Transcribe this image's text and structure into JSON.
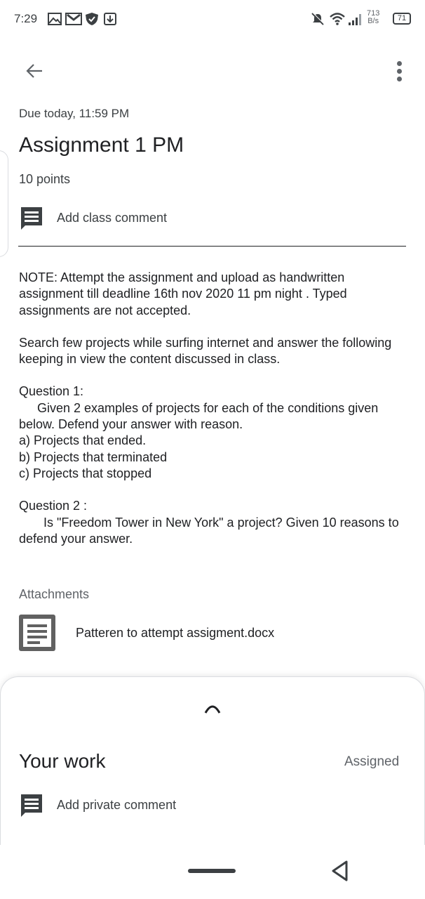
{
  "status_bar": {
    "time": "7:29",
    "net_speed_value": "713",
    "net_speed_unit": "B/s",
    "battery": "71",
    "icons": [
      "image-icon",
      "gmail-icon",
      "shield-icon",
      "download-icon",
      "mute-icon",
      "wifi-icon",
      "signal-icon"
    ]
  },
  "app_bar": {
    "back_icon": "arrow-left-icon",
    "more_icon": "more-vert-icon"
  },
  "assignment": {
    "due": "Due today, 11:59 PM",
    "title": "Assignment 1 PM",
    "points": "10 points",
    "class_comment": "Add class comment"
  },
  "description": {
    "note": "NOTE: Attempt the assignment and upload as handwritten assignment till deadline 16th nov 2020 11 pm night . Typed assignments are not accepted.",
    "search": "Search few projects while surfing internet and answer the following keeping in view the content discussed in class.",
    "q1_title": "Question 1:",
    "q1_body": "Given 2 examples of projects for each of the conditions given below. Defend your answer with reason.",
    "q1_a": "a) Projects that ended.",
    "q1_b": "b) Projects that terminated",
    "q1_c": "c) Projects that stopped",
    "q2_title": "Question 2 :",
    "q2_body": "Is \"Freedom Tower in New York\" a project? Given 10 reasons to defend your answer."
  },
  "attachments": {
    "label": "Attachments",
    "items": [
      {
        "name": "Patteren to attempt assigment.docx",
        "icon": "document-icon"
      }
    ]
  },
  "your_work": {
    "title": "Your work",
    "status": "Assigned",
    "private_comment": "Add private comment"
  },
  "colors": {
    "text_primary": "#202124",
    "text_secondary": "#5f6368",
    "doc_icon": "#616161",
    "divider": "#dadce0"
  }
}
